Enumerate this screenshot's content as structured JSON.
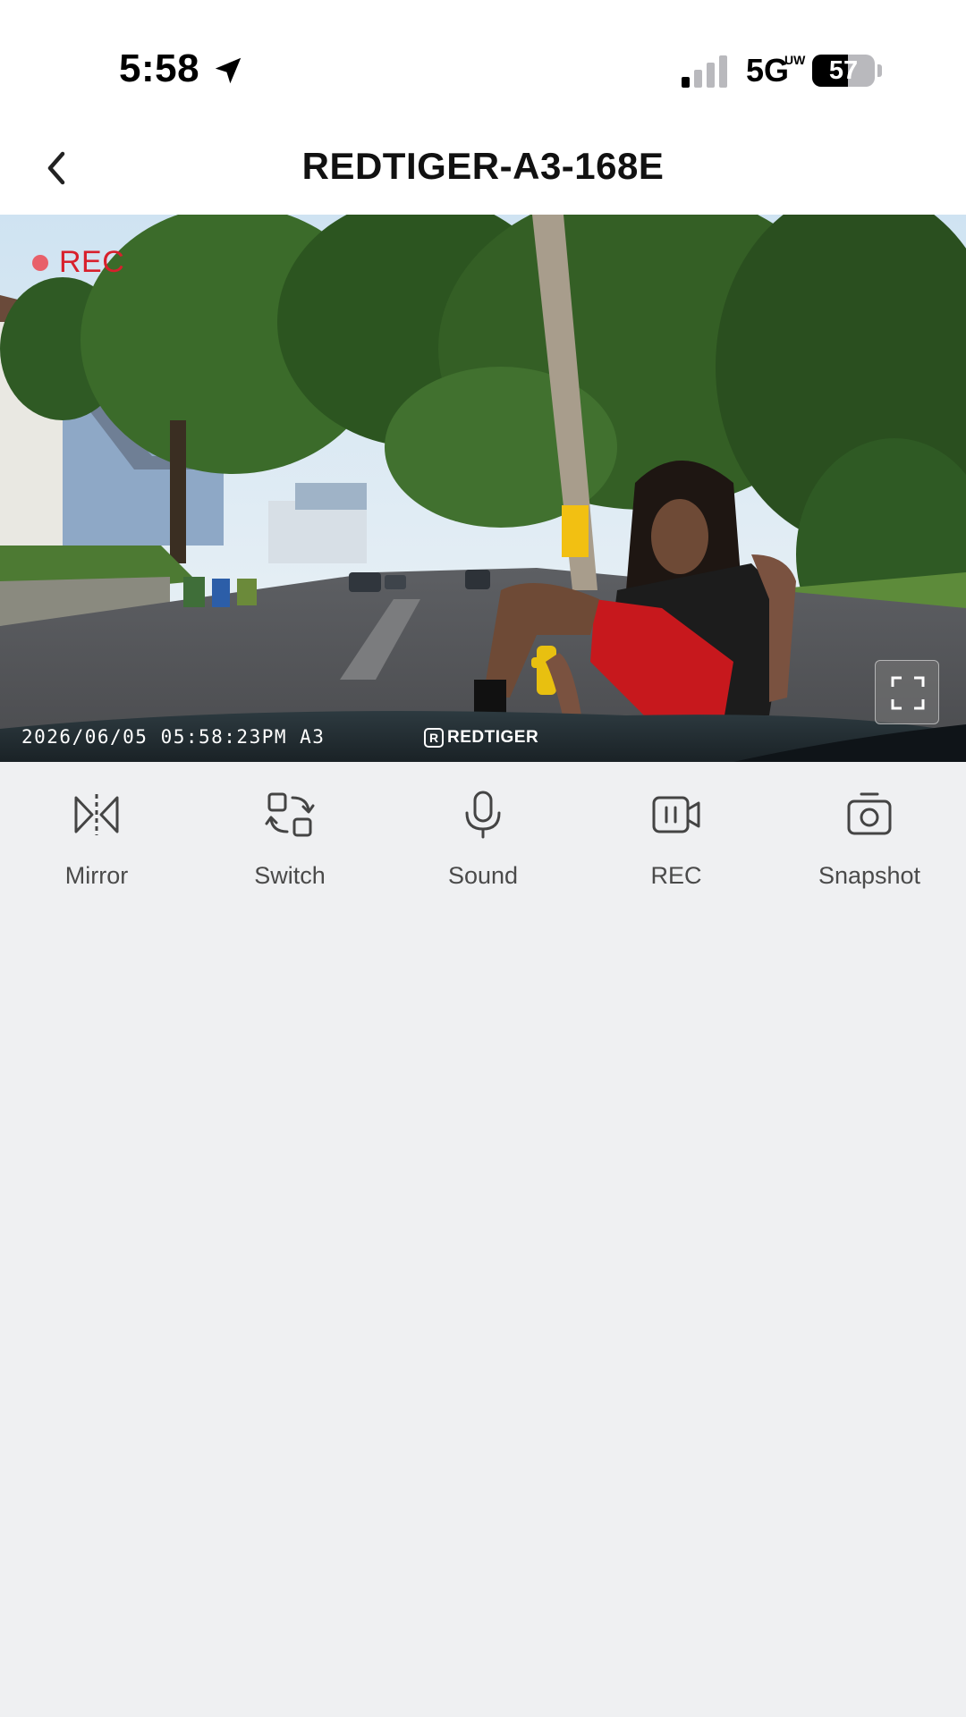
{
  "status_bar": {
    "time": "5:58",
    "network": "5G",
    "network_superscript": "UW",
    "battery_level": "57",
    "icons": [
      "location-arrow-icon",
      "signal-icon",
      "battery-icon"
    ]
  },
  "header": {
    "title": "REDTIGER-A3-168E",
    "back_icon": "chevron-left-icon"
  },
  "video": {
    "rec_label": "REC",
    "rec_color": "#d8202c",
    "timestamp": "2026/06/05 05:58:23PM A3",
    "watermark_logo": "R",
    "watermark": "REDTIGER",
    "fullscreen_icon": "fullscreen-icon"
  },
  "controls": [
    {
      "label": "Mirror",
      "icon": "mirror-icon"
    },
    {
      "label": "Switch",
      "icon": "switch-camera-icon"
    },
    {
      "label": "Sound",
      "icon": "microphone-icon"
    },
    {
      "label": "REC",
      "icon": "record-video-icon"
    },
    {
      "label": "Snapshot",
      "icon": "camera-icon"
    }
  ],
  "colors": {
    "background": "#eff0f2",
    "header_background": "#ffffff",
    "label_text": "#4a4a4a"
  }
}
